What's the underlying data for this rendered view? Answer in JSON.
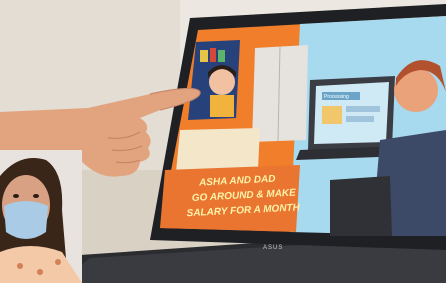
{
  "scene": {
    "type": "photograph",
    "subject": "hand pointing at laptop showing animated cartoon; inset portrait of woman in mask"
  },
  "screen_caption": {
    "lines": [
      "ASHA AND DAD",
      "GO AROUND & MAKE",
      "SALARY FOR A MONTH"
    ]
  },
  "inner_screen_label": "Processing",
  "laptop_brand": "ASUS",
  "colors": {
    "wall": "#e9e4dc",
    "table": "#d9cfc0",
    "laptop_body": "#1e1f23",
    "screen_orange": "#f07e2a",
    "screen_blue": "#9fd6ee",
    "skin": "#e2a47f"
  }
}
